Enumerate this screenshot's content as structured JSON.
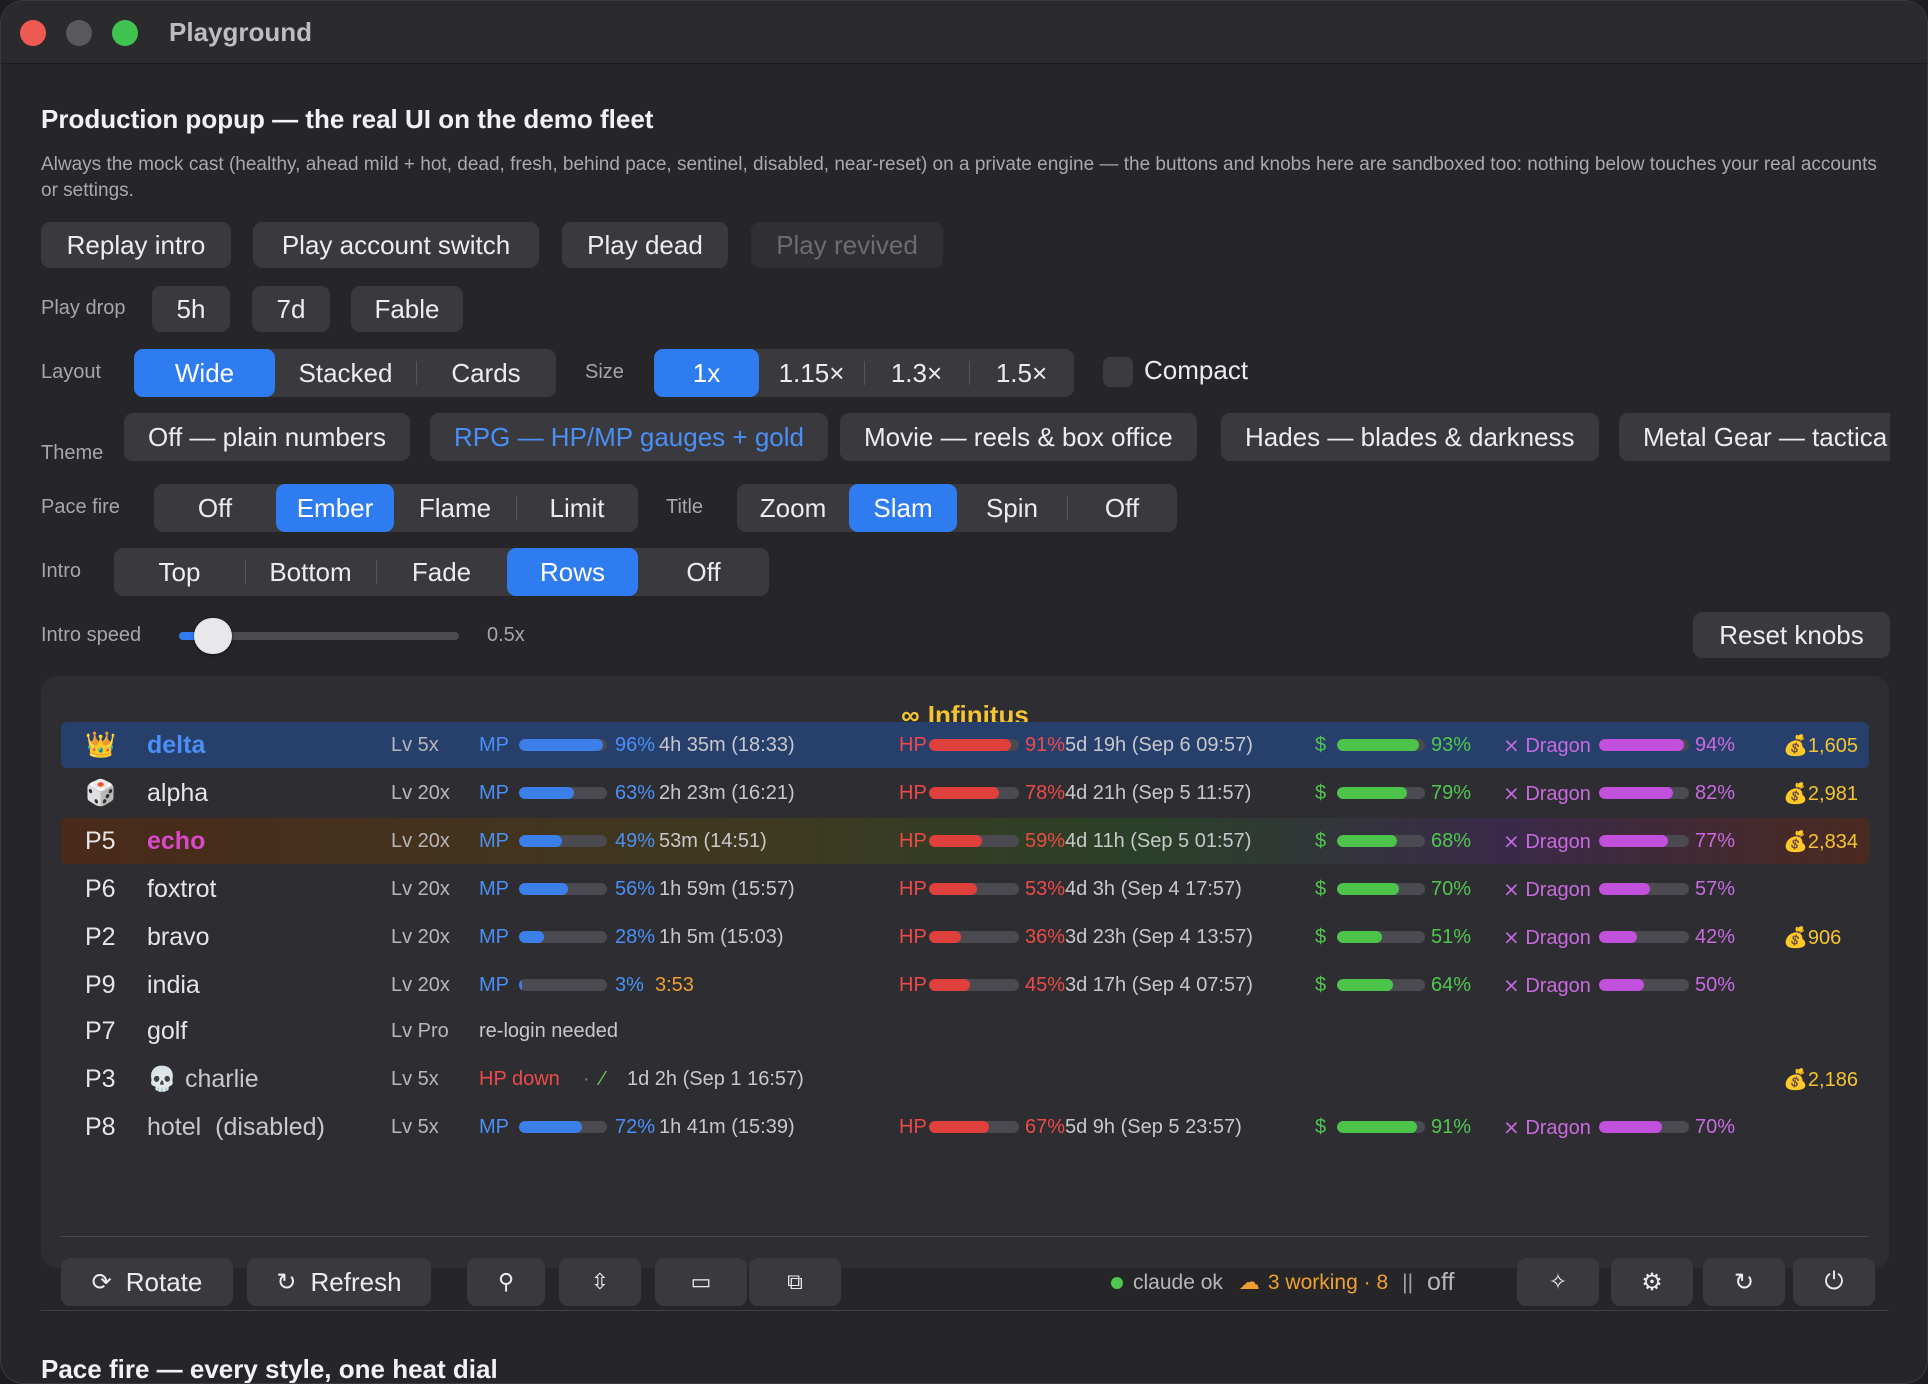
{
  "window": {
    "title": "Playground"
  },
  "header": {
    "title": "Production popup — the real UI on the demo fleet",
    "subtitle": "Always the mock cast (healthy, ahead mild + hot, dead, fresh, behind pace, sentinel, disabled, near-reset) on a private engine — the buttons and knobs here are sandboxed too: nothing below touches your real accounts or settings."
  },
  "actions": {
    "replay_intro": "Replay intro",
    "play_account_switch": "Play account switch",
    "play_dead": "Play dead",
    "play_revived": "Play revived"
  },
  "play_drop": {
    "label": "Play drop",
    "options": [
      "5h",
      "7d",
      "Fable"
    ]
  },
  "layout": {
    "label": "Layout",
    "options": [
      "Wide",
      "Stacked",
      "Cards"
    ],
    "selected": "Wide"
  },
  "size": {
    "label": "Size",
    "options": [
      "1x",
      "1.15×",
      "1.3×",
      "1.5×"
    ],
    "selected": "1x"
  },
  "compact": {
    "label": "Compact",
    "checked": false
  },
  "theme": {
    "label": "Theme",
    "options": [
      "Off — plain numbers",
      "RPG — HP/MP gauges + gold",
      "Movie — reels & box office",
      "Hades — blades & darkness",
      "Metal Gear — tactica"
    ],
    "selected": "RPG — HP/MP gauges + gold"
  },
  "pace_fire": {
    "label": "Pace fire",
    "options": [
      "Off",
      "Ember",
      "Flame",
      "Limit"
    ],
    "selected": "Ember"
  },
  "title_anim": {
    "label": "Title",
    "options": [
      "Zoom",
      "Slam",
      "Spin",
      "Off"
    ],
    "selected": "Slam"
  },
  "intro": {
    "label": "Intro",
    "options": [
      "Top",
      "Bottom",
      "Fade",
      "Rows",
      "Off"
    ],
    "selected": "Rows"
  },
  "intro_speed": {
    "label": "Intro speed",
    "value": "0.5x",
    "fraction": 0.12
  },
  "reset_knobs": "Reset knobs",
  "popup": {
    "title": "Infinitus",
    "labels": {
      "mp": "MP",
      "hp": "HP",
      "dollar": "$",
      "dragon": "⨯ Dragon"
    },
    "rows": [
      {
        "tag": "👑",
        "name": "delta",
        "lv": "Lv 5x",
        "mp_pct": "96%",
        "mp_val": 0.96,
        "mp_text": "4h 35m (18:33)",
        "hp_pct": "91%",
        "hp_val": 0.91,
        "hp_text": "5d 19h (Sep 6 09:57)",
        "d_pct": "93%",
        "d_val": 0.93,
        "dr_pct": "94%",
        "dr_val": 0.94,
        "gold": "💰1,605"
      },
      {
        "tag": "🎲",
        "name": "alpha",
        "lv": "Lv 20x",
        "mp_pct": "63%",
        "mp_val": 0.63,
        "mp_text": "2h 23m (16:21)",
        "hp_pct": "78%",
        "hp_val": 0.78,
        "hp_text": "4d 21h (Sep 5 11:57)",
        "d_pct": "79%",
        "d_val": 0.79,
        "dr_pct": "82%",
        "dr_val": 0.82,
        "gold": "💰2,981"
      },
      {
        "tag": "P5",
        "name": "echo",
        "lv": "Lv 20x",
        "mp_pct": "49%",
        "mp_val": 0.49,
        "mp_text": "53m (14:51)",
        "hp_pct": "59%",
        "hp_val": 0.59,
        "hp_text": "4d 11h (Sep 5 01:57)",
        "d_pct": "68%",
        "d_val": 0.68,
        "dr_pct": "77%",
        "dr_val": 0.77,
        "gold": "💰2,834"
      },
      {
        "tag": "P6",
        "name": "foxtrot",
        "lv": "Lv 20x",
        "mp_pct": "56%",
        "mp_val": 0.56,
        "mp_text": "1h 59m (15:57)",
        "hp_pct": "53%",
        "hp_val": 0.53,
        "hp_text": "4d 3h (Sep 4 17:57)",
        "d_pct": "70%",
        "d_val": 0.7,
        "dr_pct": "57%",
        "dr_val": 0.57,
        "gold": ""
      },
      {
        "tag": "P2",
        "name": "bravo",
        "lv": "Lv 20x",
        "mp_pct": "28%",
        "mp_val": 0.28,
        "mp_text": "1h 5m (15:03)",
        "hp_pct": "36%",
        "hp_val": 0.36,
        "hp_text": "3d 23h (Sep 4 13:57)",
        "d_pct": "51%",
        "d_val": 0.51,
        "dr_pct": "42%",
        "dr_val": 0.42,
        "gold": "💰906"
      },
      {
        "tag": "P9",
        "name": "india",
        "lv": "Lv 20x",
        "mp_pct": "3%",
        "mp_val": 0.03,
        "mp_text": "3:53",
        "hp_pct": "45%",
        "hp_val": 0.45,
        "hp_text": "3d 17h (Sep 4 07:57)",
        "d_pct": "64%",
        "d_val": 0.64,
        "dr_pct": "50%",
        "dr_val": 0.5,
        "gold": ""
      }
    ],
    "golf": {
      "tag": "P7",
      "name": "golf",
      "lv": "Lv Pro",
      "note": "re-login needed"
    },
    "charlie": {
      "tag": "P3",
      "name": "charlie",
      "lv": "Lv 5x",
      "hp_down": "HP down",
      "dot": "·",
      "text": "1d 2h (Sep 1 16:57)",
      "gold": "💰2,186"
    },
    "hotel": {
      "tag": "P8",
      "name": "hotel",
      "disabled": "(disabled)",
      "lv": "Lv 5x",
      "mp_pct": "72%",
      "mp_val": 0.72,
      "mp_text": "1h 41m (15:39)",
      "hp_pct": "67%",
      "hp_val": 0.67,
      "hp_text": "5d 9h (Sep 5 23:57)",
      "d_pct": "91%",
      "d_val": 0.91,
      "dr_pct": "70%",
      "dr_val": 0.7
    },
    "footer": {
      "rotate": "Rotate",
      "refresh": "Refresh",
      "status": "claude ok",
      "working": "3 working · 8",
      "sep": "||",
      "off": "off"
    }
  },
  "section2": {
    "title": "Pace fire — every style, one heat dial"
  },
  "colors": {
    "accent": "#2f7bf0",
    "mp": "#3d7fe8",
    "hp": "#e0403c",
    "dollar": "#4cc44c",
    "dragon": "#c150dc",
    "gold": "#f4c431"
  }
}
